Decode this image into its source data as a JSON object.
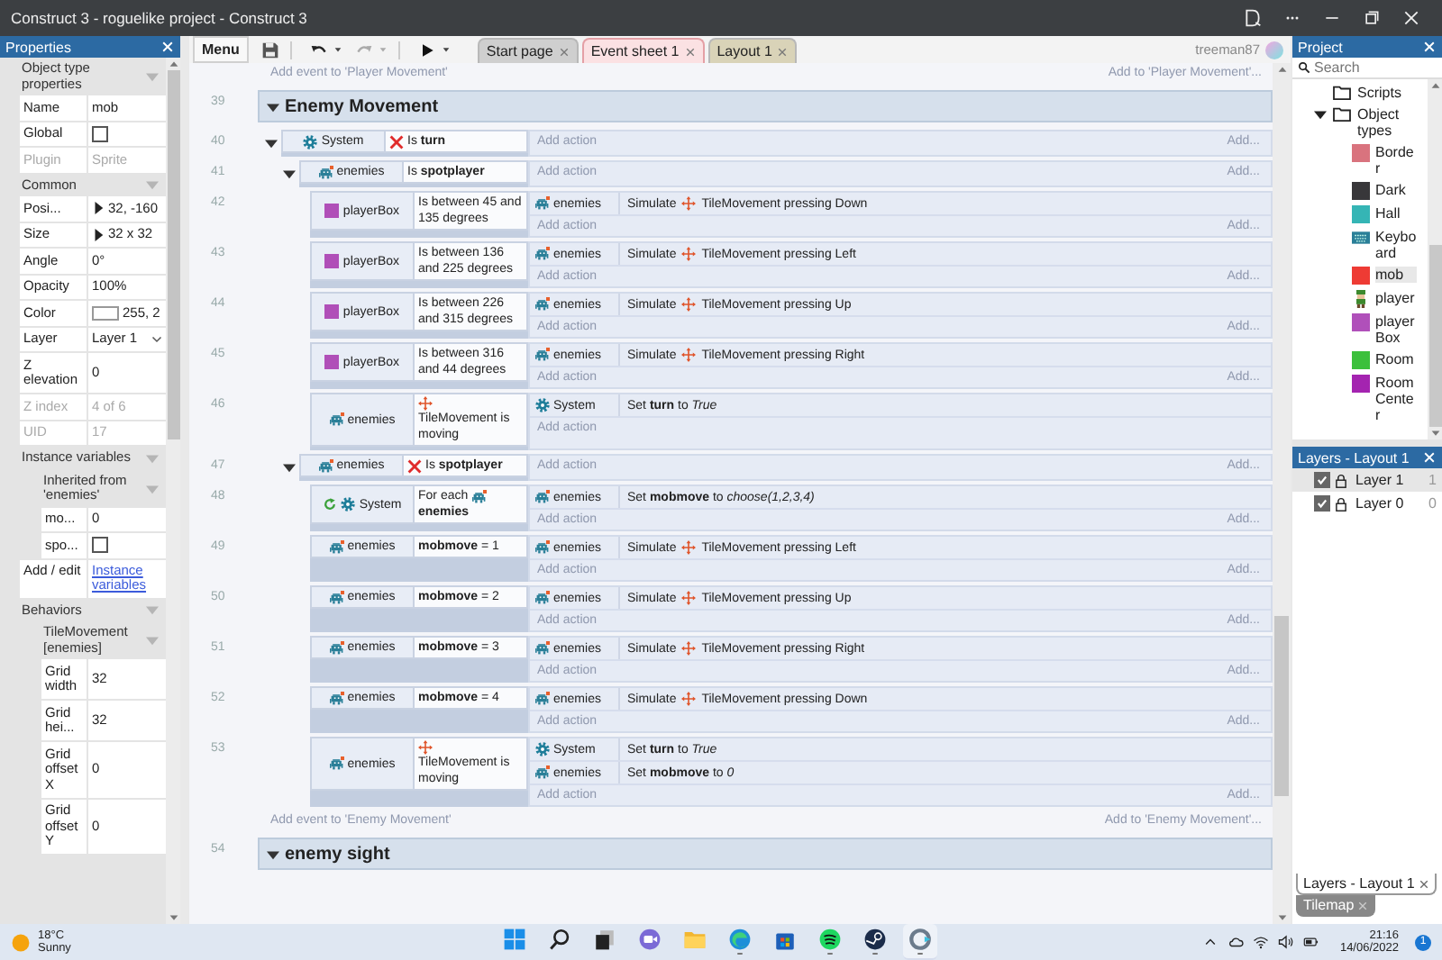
{
  "window": {
    "title": "Construct 3 - roguelike project - Construct 3"
  },
  "properties": {
    "title": "Properties",
    "sections": [
      {
        "title": "Object type properties",
        "expanded": true,
        "children": [
          {
            "kind": "text",
            "label": "Name",
            "value": "mob",
            "disabled": false
          },
          {
            "kind": "checkbox",
            "label": "Global",
            "checked": false,
            "disabled": false
          },
          {
            "kind": "text",
            "label": "Plugin",
            "value": "Sprite",
            "disabled": true
          }
        ]
      },
      {
        "title": "Common",
        "expanded": true,
        "children": [
          {
            "kind": "expander",
            "label": "Posi...",
            "value": "32, -160",
            "disabled": false
          },
          {
            "kind": "expander",
            "label": "Size",
            "value": "32 x 32",
            "disabled": false
          },
          {
            "kind": "text",
            "label": "Angle",
            "value": "0°",
            "disabled": false
          },
          {
            "kind": "text",
            "label": "Opacity",
            "value": "100%",
            "disabled": false
          },
          {
            "kind": "color",
            "label": "Color",
            "value": "255, 2",
            "disabled": false
          },
          {
            "kind": "dropdown",
            "label": "Layer",
            "value": "Layer 1",
            "disabled": false
          },
          {
            "kind": "text",
            "label": "Z elevation",
            "value": "0",
            "disabled": false
          },
          {
            "kind": "text",
            "label": "Z index",
            "value": "4 of 6",
            "disabled": true
          },
          {
            "kind": "text",
            "label": "UID",
            "value": "17",
            "disabled": true
          }
        ]
      },
      {
        "title": "Instance variables",
        "expanded": true,
        "children": [
          {
            "kind": "group",
            "title": "Inherited from 'enemies'",
            "expanded": true,
            "children": [
              {
                "kind": "text",
                "label": "mo...",
                "value": "0",
                "disabled": false
              },
              {
                "kind": "checkbox",
                "label": "spo...",
                "checked": false,
                "disabled": false
              }
            ]
          },
          {
            "kind": "link",
            "label": "Add / edit",
            "value": "Instance variables",
            "disabled": false
          }
        ]
      },
      {
        "title": "Behaviors",
        "expanded": true,
        "children": [
          {
            "kind": "group",
            "title": "TileMovement [enemies]",
            "expanded": true,
            "children": [
              {
                "kind": "text",
                "label": "Grid width",
                "value": "32",
                "disabled": false
              },
              {
                "kind": "text",
                "label": "Grid hei...",
                "value": "32",
                "disabled": false
              },
              {
                "kind": "text",
                "label": "Grid offset X",
                "value": "0",
                "disabled": false
              },
              {
                "kind": "text",
                "label": "Grid offset Y",
                "value": "0",
                "disabled": false
              }
            ]
          }
        ]
      }
    ]
  },
  "toolbar": {
    "menu": "Menu",
    "tabs": [
      {
        "label": "Start page",
        "selected": false,
        "color": "#cfcfcf"
      },
      {
        "label": "Event sheet 1",
        "selected": true,
        "color": "#fbe1e3"
      },
      {
        "label": "Layout 1",
        "selected": false,
        "color": "#d9d3b8"
      }
    ],
    "user": "treeman87"
  },
  "event_sheet": {
    "top_hint": {
      "left": "Add event to 'Player Movement'",
      "right": "Add to 'Player Movement'..."
    },
    "groups": [
      {
        "line": "39",
        "title": "Enemy Movement",
        "expanded": true,
        "footer": {
          "left": "Add event to 'Enemy Movement'",
          "right": "Add to 'Enemy Movement'..."
        },
        "events": [
          {
            "line": "40",
            "expanded": true,
            "conditions": [
              {
                "object": {
                  "kind": "system",
                  "name": "System"
                },
                "inverted": true,
                "loop": false,
                "parts": [
                  {
                    "kind": "text",
                    "text": "Is **turn**"
                  }
                ]
              }
            ],
            "add_action": "Add action",
            "add_more": "Add...",
            "children": [
              {
                "line": "41",
                "expanded": true,
                "conditions": [
                  {
                    "object": {
                      "kind": "enemies",
                      "name": "enemies"
                    },
                    "inverted": false,
                    "loop": false,
                    "parts": [
                      {
                        "kind": "text",
                        "text": "Is **spotplayer**"
                      }
                    ]
                  }
                ],
                "add_action": "Add action",
                "add_more": "Add...",
                "children": [
                  {
                    "line": "42",
                    "conditions": [
                      {
                        "object": {
                          "kind": "playerbox",
                          "name": "playerBox"
                        },
                        "inverted": false,
                        "loop": false,
                        "parts": [
                          {
                            "kind": "text",
                            "text": "Is between 45 and 135 degrees"
                          }
                        ]
                      }
                    ],
                    "actions": [
                      {
                        "object": {
                          "kind": "enemies",
                          "name": "enemies"
                        },
                        "parts": [
                          {
                            "kind": "text",
                            "text": "Simulate"
                          },
                          {
                            "kind": "behavior"
                          },
                          {
                            "kind": "text",
                            "text": "TileMovement pressing Down"
                          }
                        ]
                      }
                    ],
                    "add_action": "Add action",
                    "add_more": "Add..."
                  },
                  {
                    "line": "43",
                    "conditions": [
                      {
                        "object": {
                          "kind": "playerbox",
                          "name": "playerBox"
                        },
                        "inverted": false,
                        "loop": false,
                        "parts": [
                          {
                            "kind": "text",
                            "text": "Is between 136 and 225 degrees"
                          }
                        ]
                      }
                    ],
                    "actions": [
                      {
                        "object": {
                          "kind": "enemies",
                          "name": "enemies"
                        },
                        "parts": [
                          {
                            "kind": "text",
                            "text": "Simulate"
                          },
                          {
                            "kind": "behavior"
                          },
                          {
                            "kind": "text",
                            "text": "TileMovement pressing Left"
                          }
                        ]
                      }
                    ],
                    "add_action": "Add action",
                    "add_more": "Add..."
                  },
                  {
                    "line": "44",
                    "conditions": [
                      {
                        "object": {
                          "kind": "playerbox",
                          "name": "playerBox"
                        },
                        "inverted": false,
                        "loop": false,
                        "parts": [
                          {
                            "kind": "text",
                            "text": "Is between 226 and 315 degrees"
                          }
                        ]
                      }
                    ],
                    "actions": [
                      {
                        "object": {
                          "kind": "enemies",
                          "name": "enemies"
                        },
                        "parts": [
                          {
                            "kind": "text",
                            "text": "Simulate"
                          },
                          {
                            "kind": "behavior"
                          },
                          {
                            "kind": "text",
                            "text": "TileMovement pressing Up"
                          }
                        ]
                      }
                    ],
                    "add_action": "Add action",
                    "add_more": "Add..."
                  },
                  {
                    "line": "45",
                    "conditions": [
                      {
                        "object": {
                          "kind": "playerbox",
                          "name": "playerBox"
                        },
                        "inverted": false,
                        "loop": false,
                        "parts": [
                          {
                            "kind": "text",
                            "text": "Is between 316 and 44 degrees"
                          }
                        ]
                      }
                    ],
                    "actions": [
                      {
                        "object": {
                          "kind": "enemies",
                          "name": "enemies"
                        },
                        "parts": [
                          {
                            "kind": "text",
                            "text": "Simulate"
                          },
                          {
                            "kind": "behavior"
                          },
                          {
                            "kind": "text",
                            "text": "TileMovement pressing Right"
                          }
                        ]
                      }
                    ],
                    "add_action": "Add action",
                    "add_more": "Add..."
                  },
                  {
                    "line": "46",
                    "conditions": [
                      {
                        "object": {
                          "kind": "enemies",
                          "name": "enemies"
                        },
                        "inverted": false,
                        "loop": false,
                        "parts": [
                          {
                            "kind": "behavior"
                          },
                          {
                            "kind": "text",
                            "text": "TileMovement is moving"
                          }
                        ]
                      }
                    ],
                    "actions": [
                      {
                        "object": {
                          "kind": "system",
                          "name": "System"
                        },
                        "parts": [
                          {
                            "kind": "text",
                            "text": "Set **turn** to *True*"
                          }
                        ]
                      }
                    ],
                    "add_action": "Add action"
                  }
                ]
              },
              {
                "line": "47",
                "expanded": true,
                "conditions": [
                  {
                    "object": {
                      "kind": "enemies",
                      "name": "enemies"
                    },
                    "inverted": true,
                    "loop": false,
                    "parts": [
                      {
                        "kind": "text",
                        "text": "Is **spotplayer**"
                      }
                    ]
                  }
                ],
                "add_action": "Add action",
                "add_more": "Add...",
                "children": [
                  {
                    "line": "48",
                    "conditions": [
                      {
                        "object": {
                          "kind": "system",
                          "name": "System"
                        },
                        "inverted": false,
                        "loop": true,
                        "parts": [
                          {
                            "kind": "text",
                            "text": "For each"
                          },
                          {
                            "kind": "object"
                          },
                          {
                            "kind": "text",
                            "text": "**enemies**"
                          }
                        ]
                      }
                    ],
                    "actions": [
                      {
                        "object": {
                          "kind": "enemies",
                          "name": "enemies"
                        },
                        "parts": [
                          {
                            "kind": "text",
                            "text": "Set **mobmove** to *choose(1,2,3,4)*"
                          }
                        ]
                      }
                    ],
                    "add_action": "Add action",
                    "add_more": "Add..."
                  },
                  {
                    "line": "49",
                    "conditions": [
                      {
                        "object": {
                          "kind": "enemies",
                          "name": "enemies"
                        },
                        "inverted": false,
                        "loop": false,
                        "parts": [
                          {
                            "kind": "text",
                            "text": "**mobmove** = 1"
                          }
                        ]
                      }
                    ],
                    "actions": [
                      {
                        "object": {
                          "kind": "enemies",
                          "name": "enemies"
                        },
                        "parts": [
                          {
                            "kind": "text",
                            "text": "Simulate"
                          },
                          {
                            "kind": "behavior"
                          },
                          {
                            "kind": "text",
                            "text": "TileMovement pressing Left"
                          }
                        ]
                      }
                    ],
                    "add_action": "Add action",
                    "add_more": "Add..."
                  },
                  {
                    "line": "50",
                    "conditions": [
                      {
                        "object": {
                          "kind": "enemies",
                          "name": "enemies"
                        },
                        "inverted": false,
                        "loop": false,
                        "parts": [
                          {
                            "kind": "text",
                            "text": "**mobmove** = 2"
                          }
                        ]
                      }
                    ],
                    "actions": [
                      {
                        "object": {
                          "kind": "enemies",
                          "name": "enemies"
                        },
                        "parts": [
                          {
                            "kind": "text",
                            "text": "Simulate"
                          },
                          {
                            "kind": "behavior"
                          },
                          {
                            "kind": "text",
                            "text": "TileMovement pressing Up"
                          }
                        ]
                      }
                    ],
                    "add_action": "Add action",
                    "add_more": "Add..."
                  },
                  {
                    "line": "51",
                    "conditions": [
                      {
                        "object": {
                          "kind": "enemies",
                          "name": "enemies"
                        },
                        "inverted": false,
                        "loop": false,
                        "parts": [
                          {
                            "kind": "text",
                            "text": "**mobmove** = 3"
                          }
                        ]
                      }
                    ],
                    "actions": [
                      {
                        "object": {
                          "kind": "enemies",
                          "name": "enemies"
                        },
                        "parts": [
                          {
                            "kind": "text",
                            "text": "Simulate"
                          },
                          {
                            "kind": "behavior"
                          },
                          {
                            "kind": "text",
                            "text": "TileMovement pressing Right"
                          }
                        ]
                      }
                    ],
                    "add_action": "Add action",
                    "add_more": "Add..."
                  },
                  {
                    "line": "52",
                    "conditions": [
                      {
                        "object": {
                          "kind": "enemies",
                          "name": "enemies"
                        },
                        "inverted": false,
                        "loop": false,
                        "parts": [
                          {
                            "kind": "text",
                            "text": "**mobmove** = 4"
                          }
                        ]
                      }
                    ],
                    "actions": [
                      {
                        "object": {
                          "kind": "enemies",
                          "name": "enemies"
                        },
                        "parts": [
                          {
                            "kind": "text",
                            "text": "Simulate"
                          },
                          {
                            "kind": "behavior"
                          },
                          {
                            "kind": "text",
                            "text": "TileMovement pressing Down"
                          }
                        ]
                      }
                    ],
                    "add_action": "Add action",
                    "add_more": "Add..."
                  },
                  {
                    "line": "53",
                    "conditions": [
                      {
                        "object": {
                          "kind": "enemies",
                          "name": "enemies"
                        },
                        "inverted": false,
                        "loop": false,
                        "parts": [
                          {
                            "kind": "behavior"
                          },
                          {
                            "kind": "text",
                            "text": "TileMovement is moving"
                          }
                        ]
                      }
                    ],
                    "actions": [
                      {
                        "object": {
                          "kind": "system",
                          "name": "System"
                        },
                        "parts": [
                          {
                            "kind": "text",
                            "text": "Set **turn** to *True*"
                          }
                        ]
                      },
                      {
                        "object": {
                          "kind": "enemies",
                          "name": "enemies"
                        },
                        "parts": [
                          {
                            "kind": "text",
                            "text": "Set **mobmove** to *0*"
                          }
                        ]
                      }
                    ],
                    "add_action": "Add action",
                    "add_more": "Add..."
                  }
                ]
              }
            ]
          }
        ]
      },
      {
        "line": "54",
        "title": "enemy sight",
        "expanded": true
      }
    ]
  },
  "project": {
    "title": "Project",
    "search_placeholder": "Search",
    "items": [
      {
        "label": "Scripts",
        "kind": "folder"
      },
      {
        "label": "Object types",
        "kind": "folder",
        "expanded": true,
        "children": [
          {
            "label": "Border",
            "kind": "swatch",
            "color": "#d9737e",
            "selected": false
          },
          {
            "label": "Dark",
            "kind": "swatch",
            "color": "#38373a",
            "selected": false
          },
          {
            "label": "Hall",
            "kind": "swatch",
            "color": "#35b5b5",
            "selected": false
          },
          {
            "label": "Keyboard",
            "kind": "keyboard",
            "selected": false
          },
          {
            "label": "mob",
            "kind": "swatch",
            "color": "#ee3b34",
            "selected": true
          },
          {
            "label": "player",
            "kind": "sprite",
            "selected": false
          },
          {
            "label": "playerBox",
            "kind": "swatch",
            "color": "#b050ba",
            "selected": false
          },
          {
            "label": "Room",
            "kind": "swatch",
            "color": "#3cc03c",
            "selected": false
          },
          {
            "label": "RoomCenter",
            "kind": "swatch",
            "color": "#a424b0",
            "selected": false
          }
        ]
      }
    ]
  },
  "layers": {
    "title": "Layers - Layout 1",
    "items": [
      {
        "name": "Layer 1",
        "count": "1",
        "visible": true,
        "selected": true
      },
      {
        "name": "Layer 0",
        "count": "0",
        "visible": true,
        "selected": false
      }
    ],
    "bottom_tabs": [
      {
        "label": "Layers - Layout 1",
        "selected": true
      },
      {
        "label": "Tilemap",
        "selected": false
      }
    ]
  },
  "taskbar": {
    "weather": {
      "temperature": "18°C",
      "condition": "Sunny"
    },
    "apps": [
      {
        "kind": "start",
        "running": false
      },
      {
        "kind": "search",
        "running": false
      },
      {
        "kind": "taskview",
        "running": false
      },
      {
        "kind": "chat",
        "running": false
      },
      {
        "kind": "explorer",
        "running": false
      },
      {
        "kind": "edge",
        "running": true
      },
      {
        "kind": "store",
        "running": false
      },
      {
        "kind": "spotify",
        "running": true
      },
      {
        "kind": "steam",
        "running": true
      },
      {
        "kind": "construct",
        "running": true
      }
    ],
    "time": "21:16",
    "date": "14/06/2022",
    "notifications": "1"
  }
}
